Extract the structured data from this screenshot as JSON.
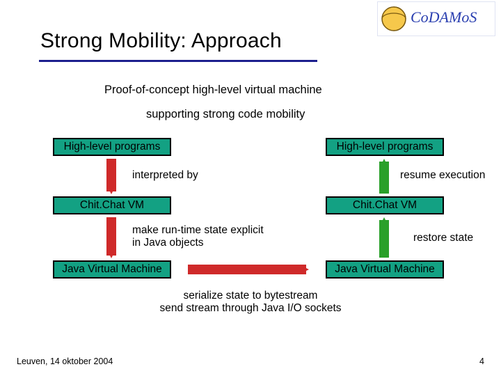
{
  "title": "Strong Mobility: Approach",
  "intro": {
    "line1": "Proof-of-concept high-level virtual machine",
    "line2": "supporting strong code mobility"
  },
  "boxes": {
    "left_top": "High-level programs",
    "right_top": "High-level programs",
    "left_mid": "Chit.Chat VM",
    "right_mid": "Chit.Chat VM",
    "left_bot": "Java Virtual Machine",
    "right_bot": "Java Virtual Machine"
  },
  "labels": {
    "interpreted_by": "interpreted by",
    "resume_execution": "resume execution",
    "make_state_l1": "make run-time state explicit",
    "make_state_l2": "in Java objects",
    "restore_state": "restore state",
    "serialize_l1": "serialize state to bytestream",
    "serialize_l2": "send stream through Java I/O sockets"
  },
  "footer": {
    "left": "Leuven, 14 oktober 2004",
    "right": "4"
  },
  "colors": {
    "box_fill": "#13a183",
    "arrow_red": "#cf2a2a",
    "arrow_green": "#2aa02a",
    "rule": "#1c1f8e"
  },
  "icons": {
    "logo": "codamos-logo"
  }
}
